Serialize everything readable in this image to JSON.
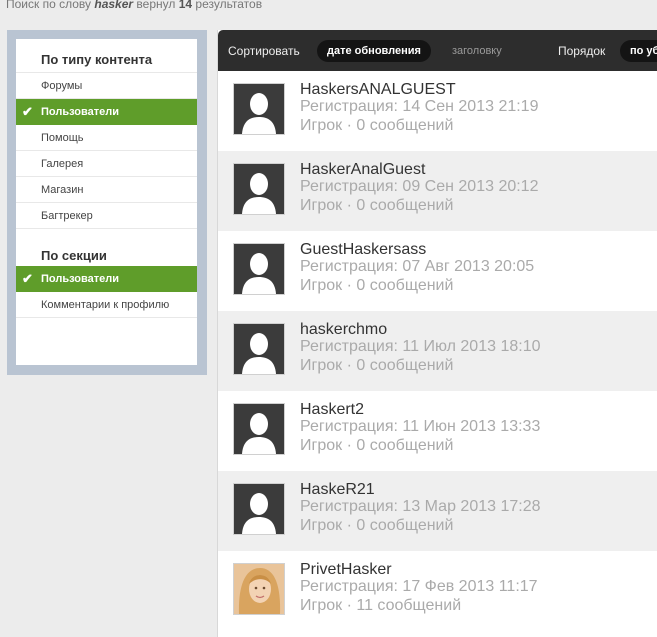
{
  "summary": {
    "prefix": "Поиск по слову",
    "query": "hasker",
    "middle": "вернул",
    "count": "14",
    "suffix": "результатов"
  },
  "sidebar": {
    "content_heading": "По типу контента",
    "content_items": [
      {
        "label": "Форумы",
        "active": false
      },
      {
        "label": "Пользователи",
        "active": true
      },
      {
        "label": "Помощь",
        "active": false
      },
      {
        "label": "Галерея",
        "active": false
      },
      {
        "label": "Магазин",
        "active": false
      },
      {
        "label": "Багтрекер",
        "active": false
      }
    ],
    "section_heading": "По секции",
    "section_items": [
      {
        "label": "Пользователи",
        "active": true
      },
      {
        "label": "Комментарии к профилю",
        "active": false
      }
    ]
  },
  "sortbar": {
    "sort_label": "Сортировать",
    "sort_active": "дате обновления",
    "sort_alt": "заголовку",
    "order_label": "Порядок",
    "order_active": "по убыванию"
  },
  "results": [
    {
      "name": "HaskersANALGUEST",
      "registered": "Регистрация: 14 Сен 2013 21:19",
      "stat": "Игрок · 0 сообщений",
      "avatar": "silhouette-icon"
    },
    {
      "name": "HaskerAnalGuest",
      "registered": "Регистрация: 09 Сен 2013 20:12",
      "stat": "Игрок · 0 сообщений",
      "avatar": "silhouette-icon"
    },
    {
      "name": "GuestHaskersass",
      "registered": "Регистрация: 07 Авг 2013 20:05",
      "stat": "Игрок · 0 сообщений",
      "avatar": "silhouette-icon"
    },
    {
      "name": "haskerchmo",
      "registered": "Регистрация: 11 Июл 2013 18:10",
      "stat": "Игрок · 0 сообщений",
      "avatar": "silhouette-icon"
    },
    {
      "name": "Haskert2",
      "registered": "Регистрация: 11 Июн 2013 13:33",
      "stat": "Игрок · 0 сообщений",
      "avatar": "silhouette-icon"
    },
    {
      "name": "HaskeR21",
      "registered": "Регистрация: 13 Мар 2013 17:28",
      "stat": "Игрок · 0 сообщений",
      "avatar": "silhouette-icon"
    },
    {
      "name": "PrivetHasker",
      "registered": "Регистрация: 17 Фев 2013 11:17",
      "stat": "Игрок · 11 сообщений",
      "avatar": "photo"
    }
  ],
  "colors": {
    "active": "#5f9d2a",
    "sidebar_frame": "#b9c4d2",
    "sortbar": "#2d2d2d"
  }
}
